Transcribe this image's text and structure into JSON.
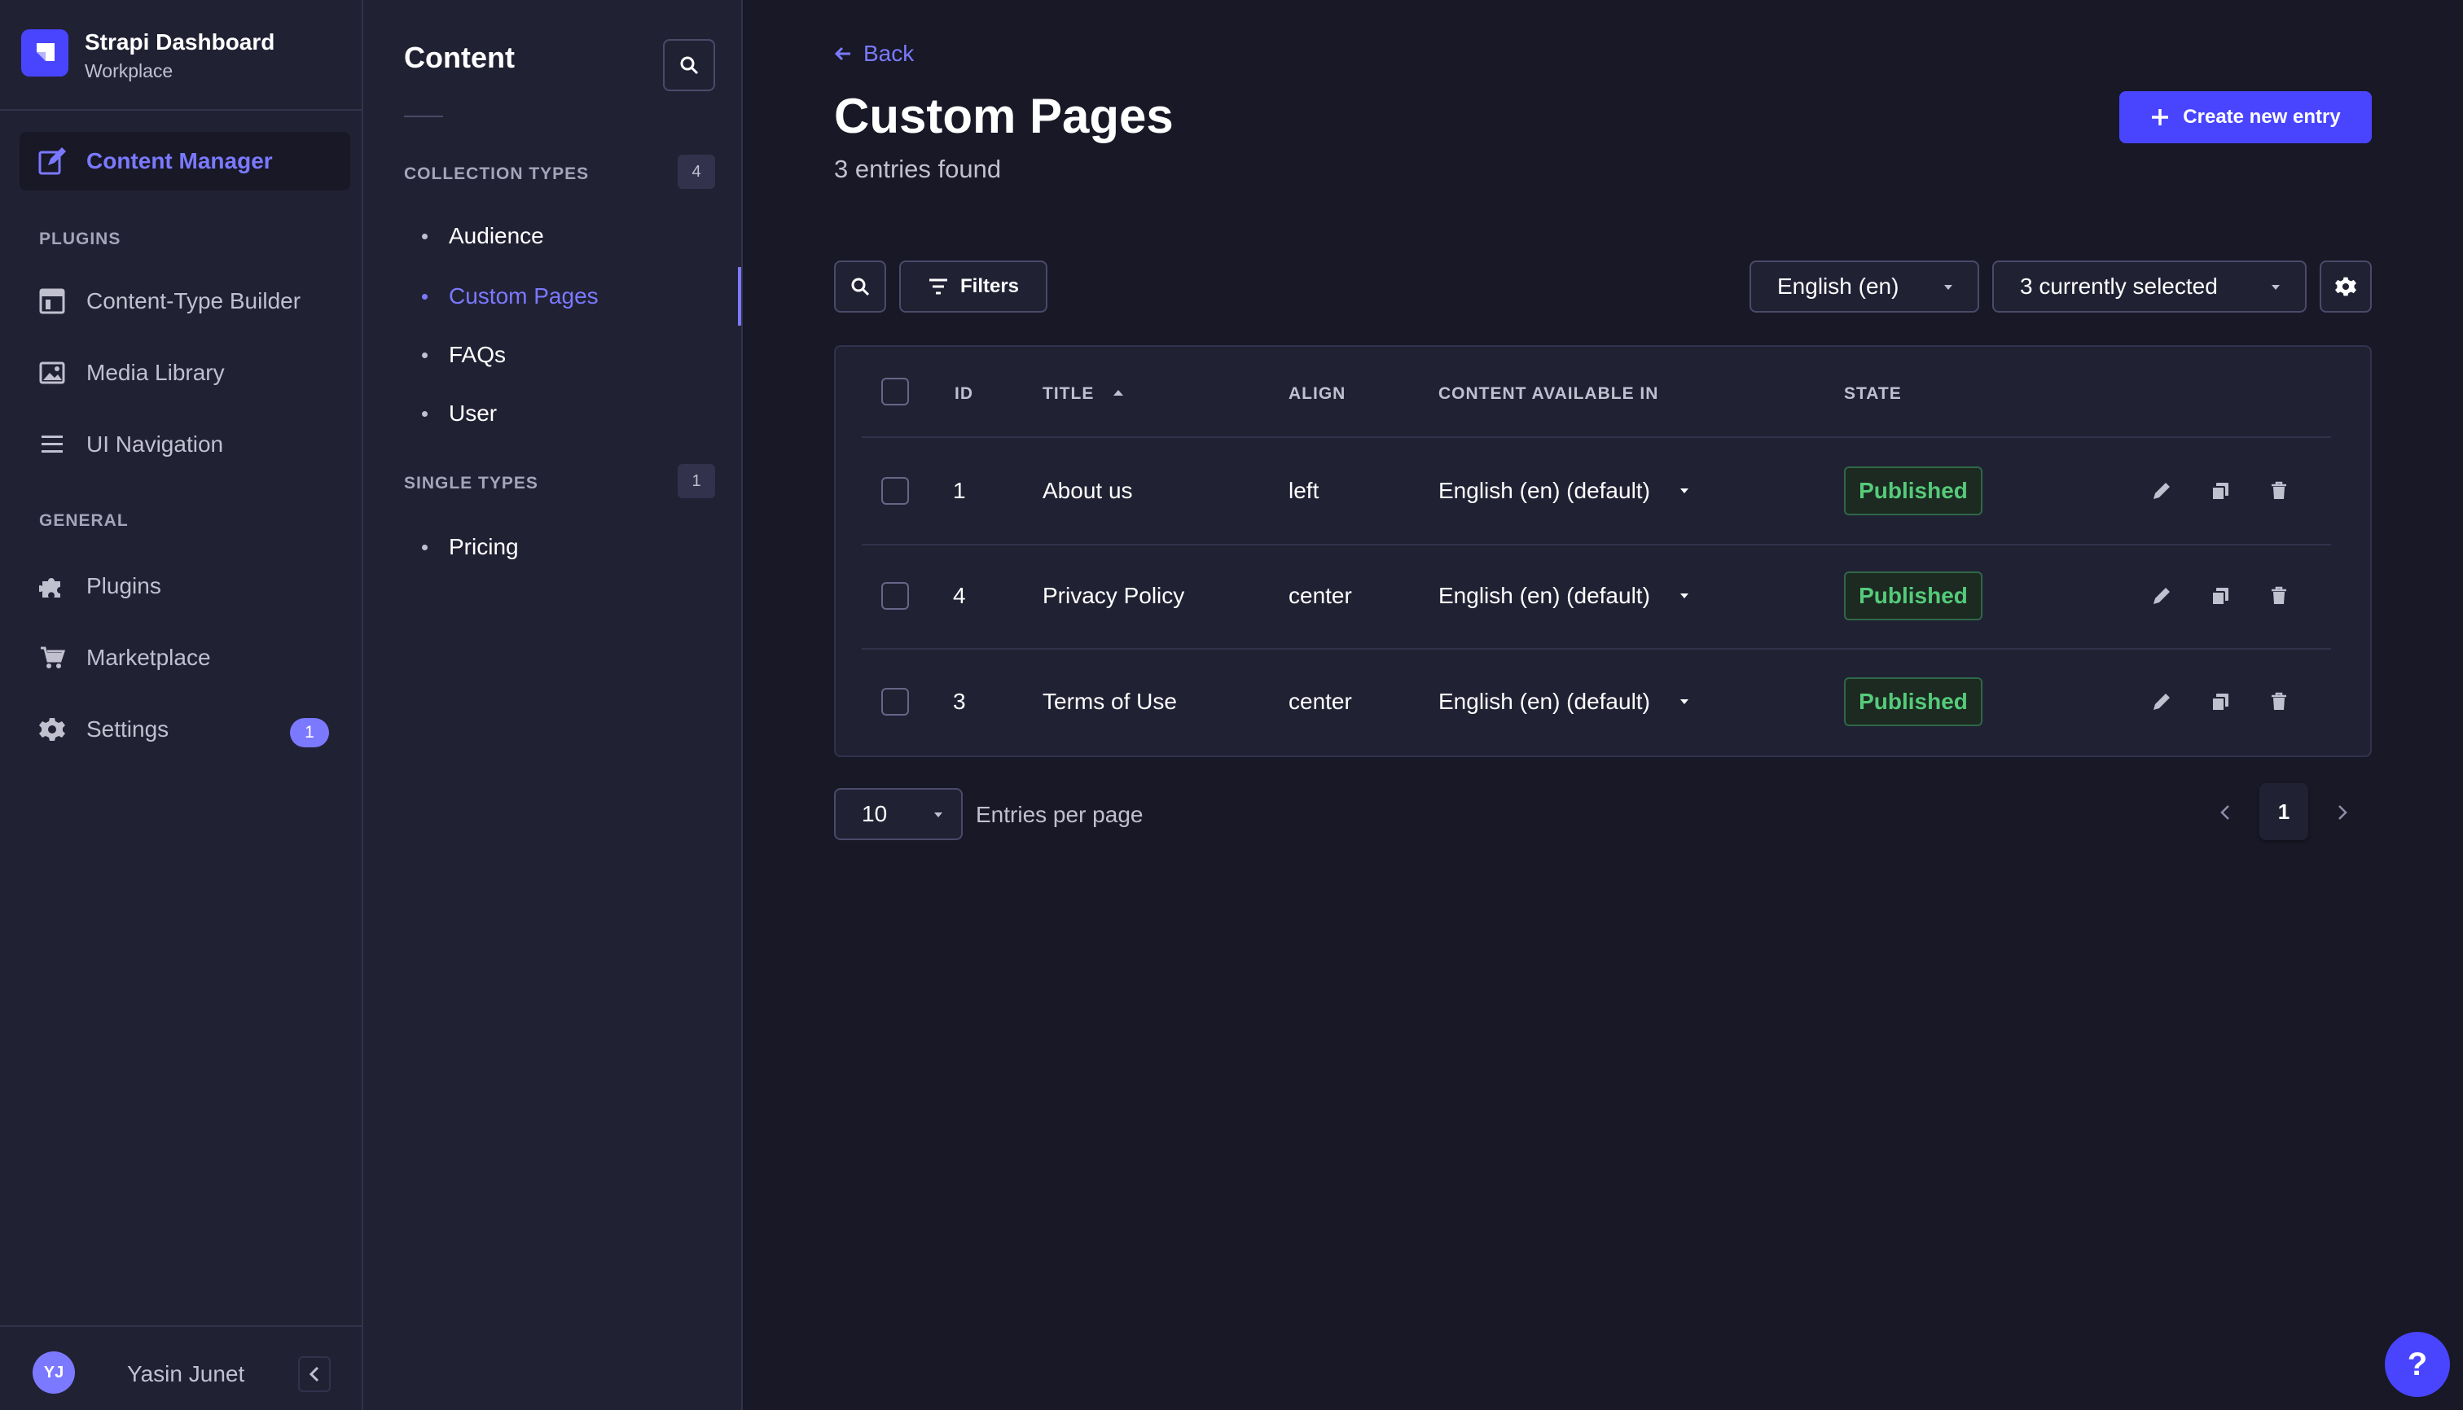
{
  "brand": {
    "title": "Strapi Dashboard",
    "subtitle": "Workplace"
  },
  "mainnav": {
    "content_manager": "Content Manager",
    "plugins_section": "PLUGINS",
    "plugins_items": [
      "Content-Type Builder",
      "Media Library",
      "UI Navigation"
    ],
    "general_section": "GENERAL",
    "general_items": [
      "Plugins",
      "Marketplace",
      "Settings"
    ],
    "settings_badge": "1"
  },
  "user": {
    "initials": "YJ",
    "name": "Yasin Junet"
  },
  "subnav": {
    "title": "Content",
    "collection_label": "COLLECTION TYPES",
    "collection_count": "4",
    "collection_items": [
      "Audience",
      "Custom Pages",
      "FAQs",
      "User"
    ],
    "single_label": "SINGLE TYPES",
    "single_count": "1",
    "single_items": [
      "Pricing"
    ]
  },
  "header": {
    "back": "Back",
    "title": "Custom Pages",
    "subtitle": "3 entries found",
    "create_button": "Create new entry"
  },
  "toolbar": {
    "filters": "Filters",
    "locale": "English (en)",
    "columns": "3 currently selected"
  },
  "table": {
    "headers": {
      "id": "ID",
      "title": "TITLE",
      "align": "ALIGN",
      "content_available": "CONTENT AVAILABLE IN",
      "state": "STATE"
    },
    "rows": [
      {
        "id": "1",
        "title": "About us",
        "align": "left",
        "locale": "English (en) (default)",
        "state": "Published"
      },
      {
        "id": "4",
        "title": "Privacy Policy",
        "align": "center",
        "locale": "English (en) (default)",
        "state": "Published"
      },
      {
        "id": "3",
        "title": "Terms of Use",
        "align": "center",
        "locale": "English (en) (default)",
        "state": "Published"
      }
    ]
  },
  "pagination": {
    "per_page": "10",
    "per_page_label": "Entries per page",
    "current_page": "1"
  },
  "help": {
    "label": "?"
  },
  "colors": {
    "accent": "#7b79ff",
    "primary": "#4945ff",
    "published": "#55cb7a",
    "background": "#181826",
    "panel": "#212134"
  }
}
